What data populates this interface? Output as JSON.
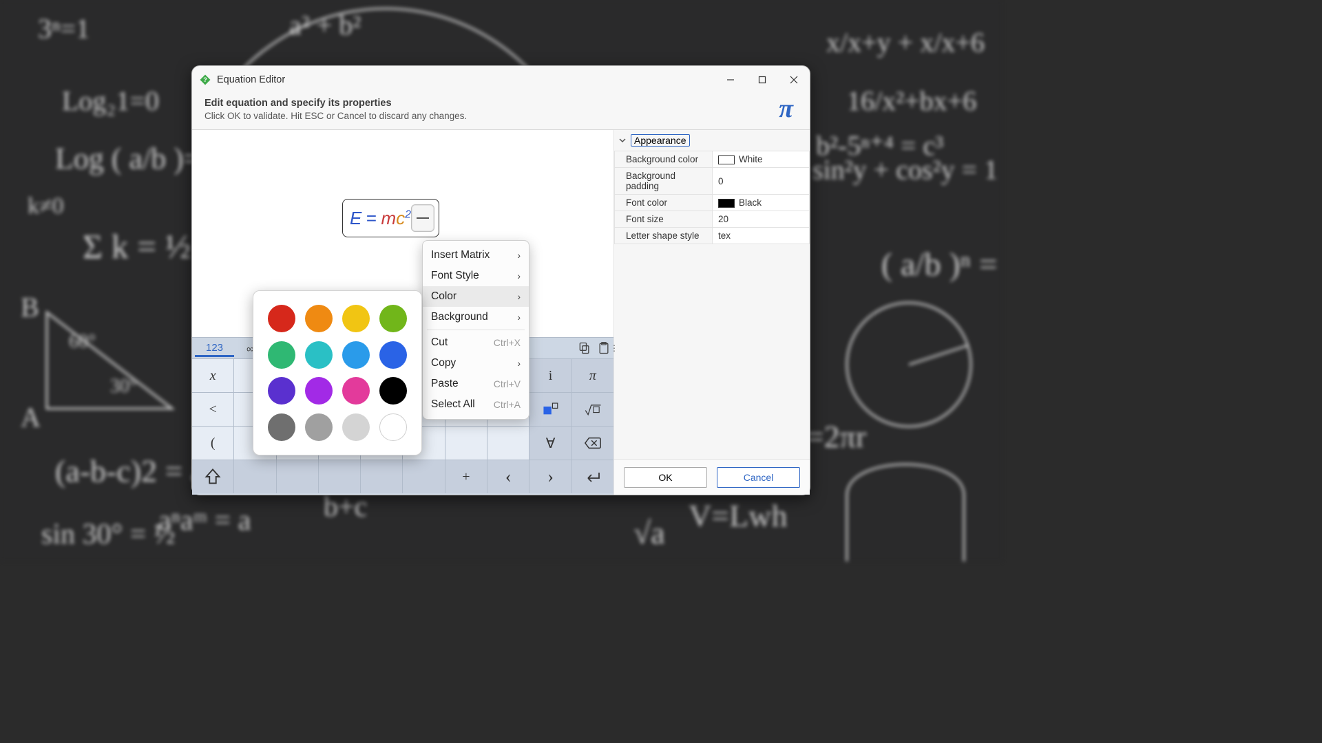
{
  "window": {
    "title": "Equation Editor",
    "subtitle": "Edit equation and specify its properties",
    "hint": "Click OK to validate. Hit ESC or Cancel to discard any changes."
  },
  "equation": {
    "lhs": "E",
    "eq": "=",
    "m": "m",
    "c": "c",
    "exp": "2"
  },
  "properties": {
    "section": "Appearance",
    "rows": [
      [
        "Background color",
        "White"
      ],
      [
        "Background padding",
        "0"
      ],
      [
        "Font color",
        "Black"
      ],
      [
        "Font size",
        "20"
      ],
      [
        "Letter shape style",
        "tex"
      ]
    ]
  },
  "footer": {
    "ok": "OK",
    "cancel": "Cancel"
  },
  "tabs": {
    "numeric": "123",
    "infinity": "∞ β"
  },
  "keypad": [
    [
      "x",
      "",
      "",
      "",
      "",
      "",
      "",
      "",
      "i",
      "π"
    ],
    [
      "<",
      "",
      "",
      "",
      "",
      "",
      "",
      "",
      "□▫",
      "√▫"
    ],
    [
      "(",
      "",
      "",
      "",
      "",
      "",
      "",
      "",
      "∀",
      "⌫"
    ],
    [
      "⇧",
      "",
      "",
      "",
      "",
      "",
      "+",
      "‹",
      "›",
      "↵"
    ]
  ],
  "context_menu": [
    {
      "label": "Insert Matrix",
      "sub": true
    },
    {
      "label": "Font Style",
      "sub": true
    },
    {
      "label": "Color",
      "sub": true,
      "hover": true
    },
    {
      "label": "Background",
      "sub": true
    },
    {
      "sep": true
    },
    {
      "label": "Cut",
      "shortcut": "Ctrl+X"
    },
    {
      "label": "Copy",
      "sub": true
    },
    {
      "label": "Paste",
      "shortcut": "Ctrl+V"
    },
    {
      "label": "Select All",
      "shortcut": "Ctrl+A"
    }
  ],
  "colors": [
    "#d6281b",
    "#ef8a12",
    "#f1c513",
    "#71b61a",
    "#2fb873",
    "#2ac0c5",
    "#2a9bea",
    "#2a63e6",
    "#5a30cf",
    "#a22ae6",
    "#e33a9b",
    "#000000",
    "#6f6f6f",
    "#a0a0a0",
    "#d4d4d4",
    "#ffffff"
  ],
  "color_names": [
    "red",
    "orange",
    "yellow",
    "green",
    "emerald",
    "teal",
    "sky",
    "blue",
    "indigo",
    "violet",
    "pink",
    "black",
    "gray-dark",
    "gray",
    "gray-light",
    "white"
  ]
}
